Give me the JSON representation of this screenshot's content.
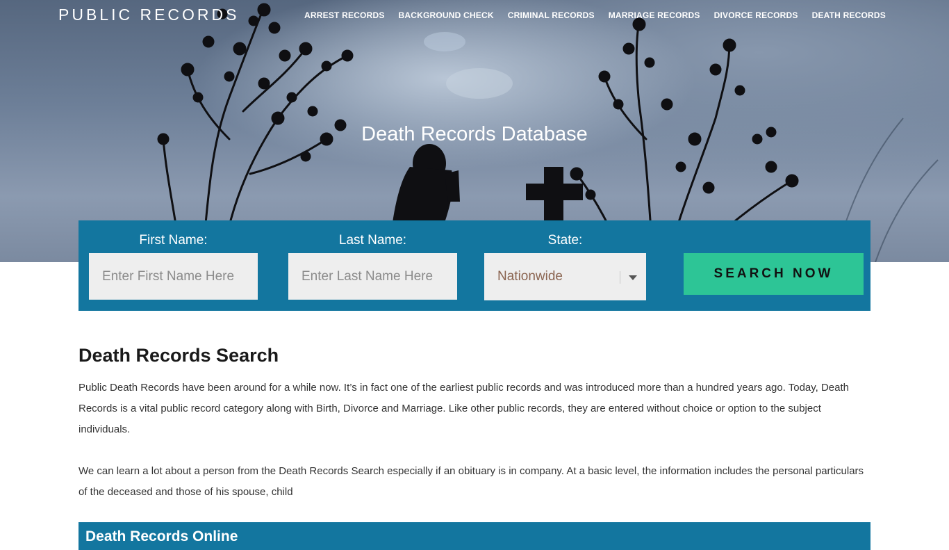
{
  "brand": "PUBLIC RECORDS",
  "nav": [
    "ARREST RECORDS",
    "BACKGROUND CHECK",
    "CRIMINAL RECORDS",
    "MARRIAGE RECORDS",
    "DIVORCE RECORDS",
    "DEATH RECORDS"
  ],
  "hero": {
    "title": "Death Records Database"
  },
  "search": {
    "first_name": {
      "label": "First Name:",
      "placeholder": "Enter First Name Here"
    },
    "last_name": {
      "label": "Last Name:",
      "placeholder": "Enter Last Name Here"
    },
    "state": {
      "label": "State:",
      "value": "Nationwide"
    },
    "button": "SEARCH NOW"
  },
  "main": {
    "heading": "Death Records Search",
    "paragraphs": [
      "Public Death Records have been around for a while now. It’s in fact one of the earliest public records and was introduced more than a hundred years ago. Today, Death Records is a vital public record category along with Birth, Divorce and Marriage. Like other public records, they are entered without choice or option to the subject individuals.",
      "We can learn a lot about a person from the Death Records Search especially if an obituary is in company. At a basic level, the information includes the personal particulars of the deceased and those of his spouse, child"
    ],
    "bottom_heading": "Death Records Online"
  },
  "colors": {
    "panel": "#13769f",
    "button": "#2dc596"
  }
}
